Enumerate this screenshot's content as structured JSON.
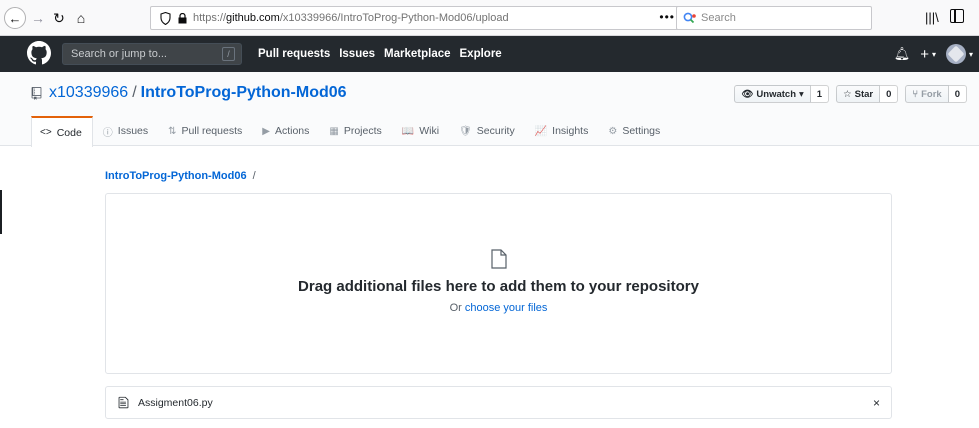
{
  "browser": {
    "url_prefix": "https://",
    "url_domain": "github.com",
    "url_path": "/x10339966/IntroToProg-Python-Mod06/upload",
    "page_actions": "•••",
    "search_placeholder": "Search"
  },
  "gh_header": {
    "search_placeholder": "Search or jump to...",
    "slash_hint": "/",
    "nav": [
      "Pull requests",
      "Issues",
      "Marketplace",
      "Explore"
    ]
  },
  "repo": {
    "owner": "x10339966",
    "separator": "/",
    "name": "IntroToProg-Python-Mod06",
    "actions": {
      "watch_label": "Unwatch",
      "watch_count": "1",
      "star_label": "Star",
      "star_count": "0",
      "fork_label": "Fork",
      "fork_count": "0"
    },
    "tabs": [
      {
        "label": "Code",
        "icon": "<>"
      },
      {
        "label": "Issues",
        "icon": "ⓘ"
      },
      {
        "label": "Pull requests",
        "icon": "⇅"
      },
      {
        "label": "Actions",
        "icon": "▶"
      },
      {
        "label": "Projects",
        "icon": "▦"
      },
      {
        "label": "Wiki",
        "icon": "📖"
      },
      {
        "label": "Security",
        "icon": "🛡"
      },
      {
        "label": "Insights",
        "icon": "📈"
      },
      {
        "label": "Settings",
        "icon": "⚙"
      }
    ]
  },
  "upload": {
    "breadcrumb_repo": "IntroToProg-Python-Mod06",
    "breadcrumb_sep": "/",
    "drop_title": "Drag additional files here to add them to your repository",
    "or_text": "Or ",
    "choose_link": "choose your files",
    "files": [
      {
        "name": "Assigment06.py"
      }
    ],
    "remove_glyph": "×"
  },
  "colors": {
    "gh_header_bg": "#24292e",
    "link": "#0366d6",
    "selected_tab_accent": "#e36209"
  }
}
